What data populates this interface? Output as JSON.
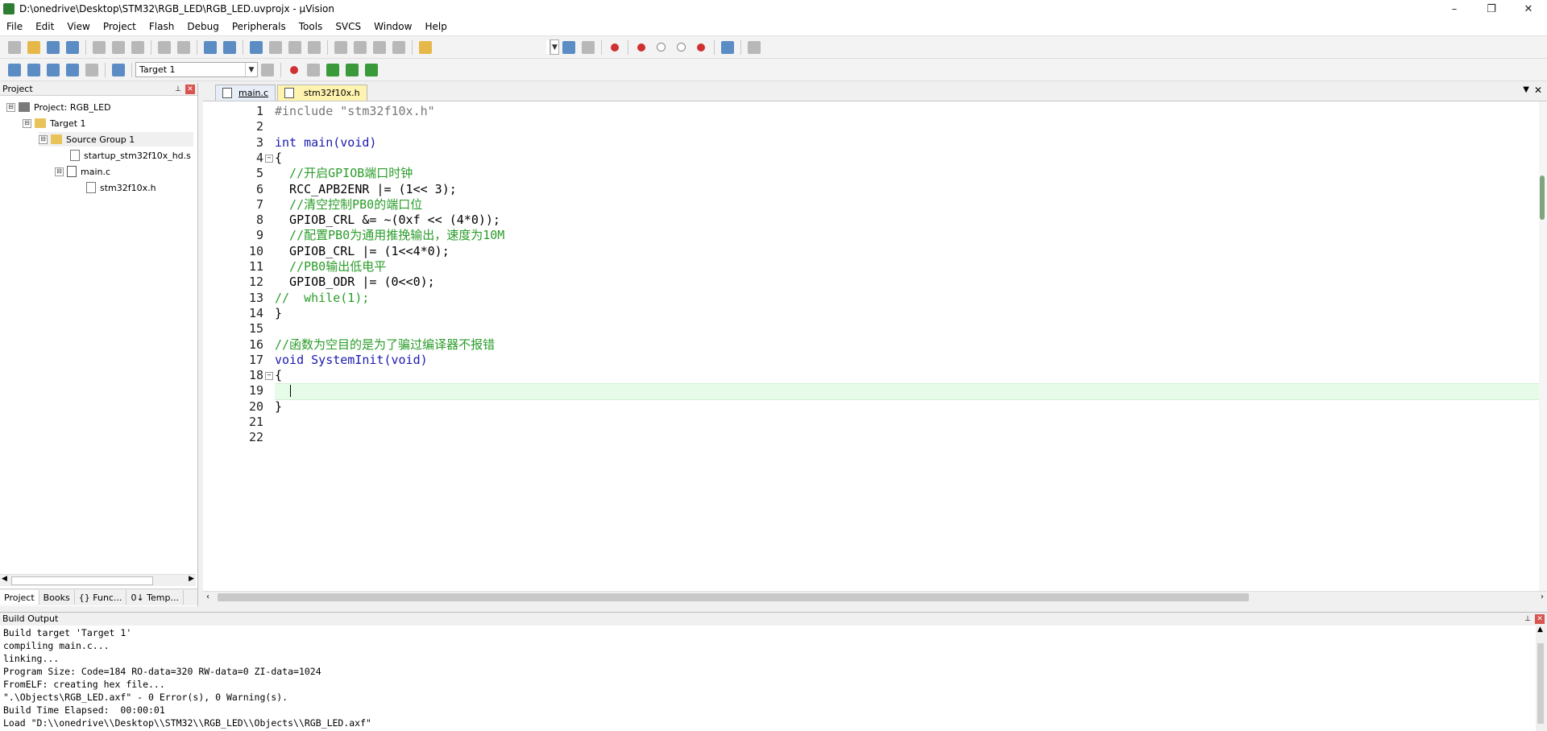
{
  "window": {
    "title": "D:\\onedrive\\Desktop\\STM32\\RGB_LED\\RGB_LED.uvprojx - µVision",
    "controls": [
      "–",
      "❐",
      "✕"
    ]
  },
  "menu": [
    "File",
    "Edit",
    "View",
    "Project",
    "Flash",
    "Debug",
    "Peripherals",
    "Tools",
    "SVCS",
    "Window",
    "Help"
  ],
  "toolbar2": {
    "target": "Target 1"
  },
  "project_panel": {
    "header": "Project",
    "tree": [
      {
        "label": "Project: RGB_LED",
        "expander": "⊟",
        "icon": "project-icon"
      },
      {
        "label": "Target 1",
        "expander": "⊟",
        "icon": "folder-icon"
      },
      {
        "label": "Source Group 1",
        "expander": "⊟",
        "icon": "folder-icon"
      },
      {
        "label": "startup_stm32f10x_hd.s",
        "expander": "",
        "icon": "asm-file-icon"
      },
      {
        "label": "main.c",
        "expander": "⊟",
        "icon": "c-file-icon"
      },
      {
        "label": "stm32f10x.h",
        "expander": "",
        "icon": "header-file-icon"
      }
    ],
    "tabs": [
      "Project",
      "Books",
      "{} Func...",
      "0↓ Temp..."
    ]
  },
  "editor": {
    "tabs": [
      "main.c",
      "stm32f10x.h"
    ],
    "active_tab": "main.c",
    "current_line": 19,
    "lines": [
      {
        "n": "1",
        "t": "#include \"stm32f10x.h\"",
        "c": "pre"
      },
      {
        "n": "2",
        "t": "",
        "c": ""
      },
      {
        "n": "3",
        "t": "int main(void)",
        "c": "kw"
      },
      {
        "n": "4",
        "t": "{",
        "c": ""
      },
      {
        "n": "5",
        "t": "  //开启GPIOB端口时钟",
        "c": "cmt"
      },
      {
        "n": "6",
        "t": "  RCC_APB2ENR |= (1<< 3);",
        "c": ""
      },
      {
        "n": "7",
        "t": "  //清空控制PB0的端口位",
        "c": "cmt"
      },
      {
        "n": "8",
        "t": "  GPIOB_CRL &= ~(0xf << (4*0));",
        "c": ""
      },
      {
        "n": "9",
        "t": "  //配置PB0为通用推挽输出，速度为10M",
        "c": "cmt"
      },
      {
        "n": "10",
        "t": "  GPIOB_CRL |= (1<<4*0);",
        "c": ""
      },
      {
        "n": "11",
        "t": "  //PB0输出低电平",
        "c": "cmt"
      },
      {
        "n": "12",
        "t": "  GPIOB_ODR |= (0<<0);",
        "c": ""
      },
      {
        "n": "13",
        "t": "//  while(1);",
        "c": "cmt"
      },
      {
        "n": "14",
        "t": "}",
        "c": ""
      },
      {
        "n": "15",
        "t": "",
        "c": ""
      },
      {
        "n": "16",
        "t": "//函数为空目的是为了骗过编译器不报错",
        "c": "cmt"
      },
      {
        "n": "17",
        "t": "void SystemInit(void)",
        "c": "kw"
      },
      {
        "n": "18",
        "t": "{",
        "c": ""
      },
      {
        "n": "19",
        "t": "  ",
        "c": ""
      },
      {
        "n": "20",
        "t": "}",
        "c": ""
      },
      {
        "n": "21",
        "t": "",
        "c": ""
      },
      {
        "n": "22",
        "t": "",
        "c": ""
      }
    ]
  },
  "build_output": {
    "header": "Build Output",
    "lines": [
      "Build target 'Target 1'",
      "compiling main.c...",
      "linking...",
      "Program Size: Code=184 RO-data=320 RW-data=0 ZI-data=1024",
      "FromELF: creating hex file...",
      "\".\\Objects\\RGB_LED.axf\" - 0 Error(s), 0 Warning(s).",
      "Build Time Elapsed:  00:00:01",
      "Load \"D:\\\\onedrive\\\\Desktop\\\\STM32\\\\RGB_LED\\\\Objects\\\\RGB_LED.axf\""
    ]
  },
  "colors": {
    "comment": "#2a9c2a",
    "keyword": "#1a1ab0",
    "string": "#a31aa3",
    "current_line": "#e6fbe8"
  }
}
